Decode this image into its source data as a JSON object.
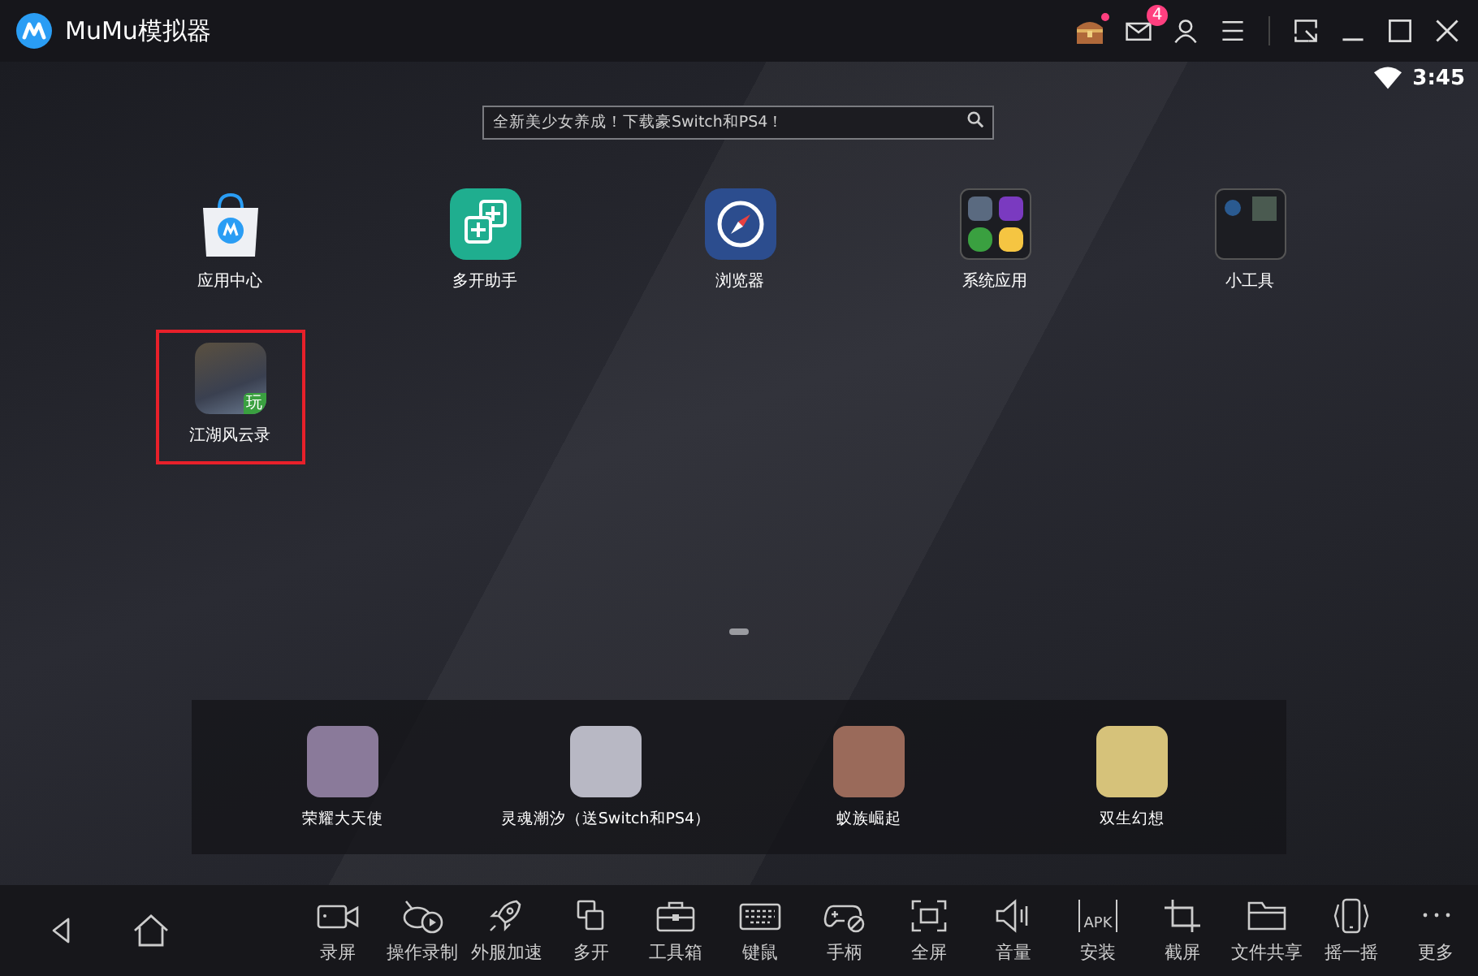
{
  "window": {
    "title": "MuMu模拟器",
    "mail_badge": "4",
    "gift_dot": true
  },
  "status_bar": {
    "time": "3:45"
  },
  "search": {
    "placeholder": "全新美少女养成！下载豪Switch和PS4！"
  },
  "apps": [
    {
      "label": "应用中心",
      "kind": "store",
      "selected": false
    },
    {
      "label": "多开助手",
      "kind": "multi",
      "selected": false
    },
    {
      "label": "浏览器",
      "kind": "browser",
      "selected": false
    },
    {
      "label": "系统应用",
      "kind": "folder",
      "selected": false
    },
    {
      "label": "小工具",
      "kind": "tools",
      "selected": false
    },
    {
      "label": "江湖风云录",
      "kind": "game",
      "badge": "玩",
      "selected": true
    }
  ],
  "dock": [
    {
      "label": "荣耀大天使"
    },
    {
      "label": "灵魂潮汐（送Switch和PS4）"
    },
    {
      "label": "蚁族崛起"
    },
    {
      "label": "双生幻想"
    }
  ],
  "toolbar": [
    {
      "label": "录屏",
      "kind": "record"
    },
    {
      "label": "操作录制",
      "kind": "macro"
    },
    {
      "label": "外服加速",
      "kind": "rocket"
    },
    {
      "label": "多开",
      "kind": "multi"
    },
    {
      "label": "工具箱",
      "kind": "toolbox"
    },
    {
      "label": "键鼠",
      "kind": "keyboard"
    },
    {
      "label": "手柄",
      "kind": "gamepad"
    },
    {
      "label": "全屏",
      "kind": "fullscreen"
    },
    {
      "label": "音量",
      "kind": "volume"
    },
    {
      "label": "安装",
      "kind": "apk",
      "icon_text": "APK"
    },
    {
      "label": "截屏",
      "kind": "crop"
    },
    {
      "label": "文件共享",
      "kind": "folder"
    },
    {
      "label": "摇一摇",
      "kind": "shake"
    },
    {
      "label": "更多",
      "kind": "more"
    }
  ]
}
